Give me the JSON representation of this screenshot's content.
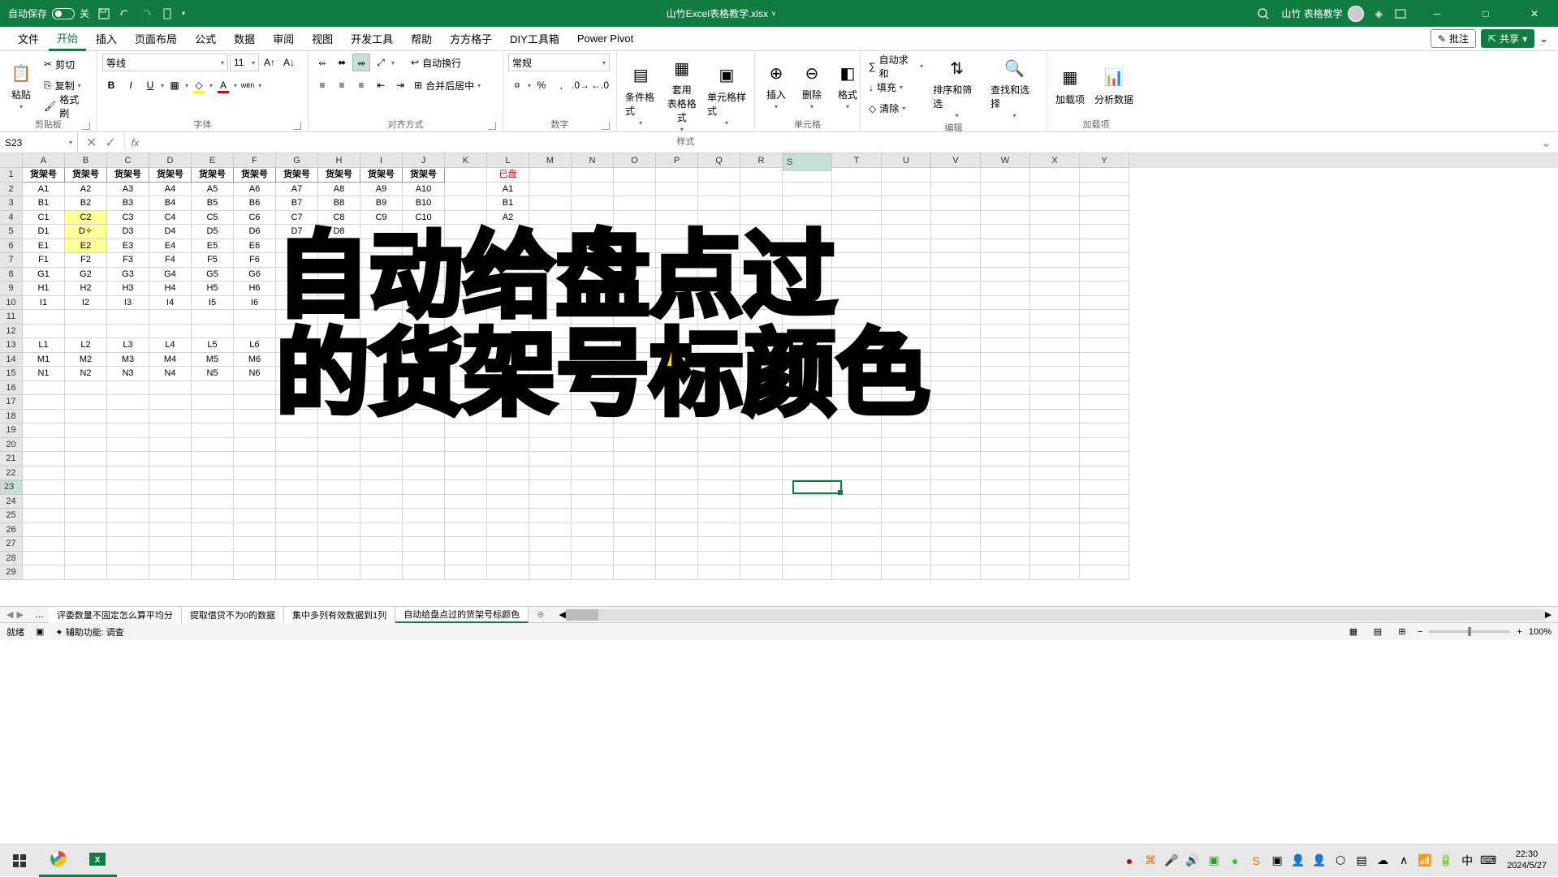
{
  "titlebar": {
    "autosave": "自动保存",
    "autosave_state": "关",
    "filename": "山竹Excel表格教学.xlsx",
    "username": "山竹 表格教学"
  },
  "tabs": [
    "文件",
    "开始",
    "插入",
    "页面布局",
    "公式",
    "数据",
    "审阅",
    "视图",
    "开发工具",
    "帮助",
    "方方格子",
    "DIY工具箱",
    "Power Pivot"
  ],
  "tab_actions": {
    "comment": "批注",
    "share": "共享"
  },
  "ribbon": {
    "clipboard": {
      "paste": "粘贴",
      "cut": "剪切",
      "copy": "复制",
      "painter": "格式刷",
      "label": "剪贴板"
    },
    "font": {
      "name": "等线",
      "size": "11",
      "label": "字体",
      "pinyin": "wén"
    },
    "align": {
      "wrap": "自动换行",
      "merge": "合并后居中",
      "label": "对齐方式"
    },
    "number": {
      "format": "常规",
      "label": "数字"
    },
    "styles": {
      "cond": "条件格式",
      "table": "套用\n表格格式",
      "cell": "单元格样式",
      "label": "样式"
    },
    "cells": {
      "insert": "插入",
      "delete": "删除",
      "format": "格式",
      "label": "单元格"
    },
    "editing": {
      "sum": "自动求和",
      "fill": "填充",
      "clear": "清除",
      "sort": "排序和筛选",
      "find": "查找和选择",
      "label": "编辑"
    },
    "addins": {
      "load": "加载项",
      "analyze": "分析数据",
      "label": "加载项"
    }
  },
  "namebox": "S23",
  "formula": "",
  "columns": [
    "A",
    "B",
    "C",
    "D",
    "E",
    "F",
    "G",
    "H",
    "I",
    "J",
    "K",
    "L",
    "M",
    "N",
    "O",
    "P",
    "Q",
    "R",
    "S",
    "T",
    "U",
    "V",
    "W",
    "X",
    "Y"
  ],
  "row_count": 29,
  "selected_col": "S",
  "selected_row": 23,
  "headers": {
    "shelf": "货架号",
    "done": "已盘"
  },
  "highlighted_cells": [
    "B4",
    "B5",
    "B6"
  ],
  "cursor_cell": "B5",
  "grid": [
    [
      "货架号",
      "货架号",
      "货架号",
      "货架号",
      "货架号",
      "货架号",
      "货架号",
      "货架号",
      "货架号",
      "货架号",
      "",
      "已盘"
    ],
    [
      "A1",
      "A2",
      "A3",
      "A4",
      "A5",
      "A6",
      "A7",
      "A8",
      "A9",
      "A10",
      "",
      "A1"
    ],
    [
      "B1",
      "B2",
      "B3",
      "B4",
      "B5",
      "B6",
      "B7",
      "B8",
      "B9",
      "B10",
      "",
      "B1"
    ],
    [
      "C1",
      "C2",
      "C3",
      "C4",
      "C5",
      "C6",
      "C7",
      "C8",
      "C9",
      "C10",
      "",
      "A2"
    ],
    [
      "D1",
      "D2",
      "D3",
      "D4",
      "D5",
      "D6",
      "D7",
      "D8",
      "",
      "",
      "",
      ""
    ],
    [
      "E1",
      "E2",
      "E3",
      "E4",
      "E5",
      "E6",
      "E7",
      "",
      "",
      "",
      "",
      ""
    ],
    [
      "F1",
      "F2",
      "F3",
      "F4",
      "F5",
      "F6",
      "F7",
      "",
      "",
      "",
      "",
      ""
    ],
    [
      "G1",
      "G2",
      "G3",
      "G4",
      "G5",
      "G6",
      "G7",
      "",
      "",
      "",
      "",
      ""
    ],
    [
      "H1",
      "H2",
      "H3",
      "H4",
      "H5",
      "H6",
      "H7",
      "",
      "",
      "",
      "",
      ""
    ],
    [
      "I1",
      "I2",
      "I3",
      "I4",
      "I5",
      "I6",
      "I7",
      "",
      "",
      "",
      "",
      ""
    ],
    [
      "",
      "",
      "",
      "",
      "",
      "",
      "",
      "",
      "",
      "",
      "",
      ""
    ],
    [
      "",
      "",
      "",
      "",
      "",
      "",
      "",
      "",
      "",
      "",
      "",
      ""
    ],
    [
      "L1",
      "L2",
      "L3",
      "L4",
      "L5",
      "L6",
      "",
      "",
      "",
      "",
      "",
      ""
    ],
    [
      "M1",
      "M2",
      "M3",
      "M4",
      "M5",
      "M6",
      "",
      "",
      "",
      "",
      "",
      ""
    ],
    [
      "N1",
      "N2",
      "N3",
      "N4",
      "N5",
      "N6",
      "",
      "",
      "",
      "",
      "",
      ""
    ]
  ],
  "sheets": {
    "nav_ellipsis": "…",
    "tabs": [
      "评委数量不固定怎么算平均分",
      "提取借贷不为0的数据",
      "集中多列有效数据到1列",
      "自动给盘点过的货架号标颜色"
    ],
    "active_index": 3
  },
  "status": {
    "ready": "就绪",
    "access": "辅助功能: 调查",
    "zoom": "100%"
  },
  "overlay": {
    "line1": "自动给盘点过",
    "line2": "的货架号标颜色"
  },
  "taskbar": {
    "time": "22:30",
    "date": "2024/5/27",
    "ime": "中"
  }
}
